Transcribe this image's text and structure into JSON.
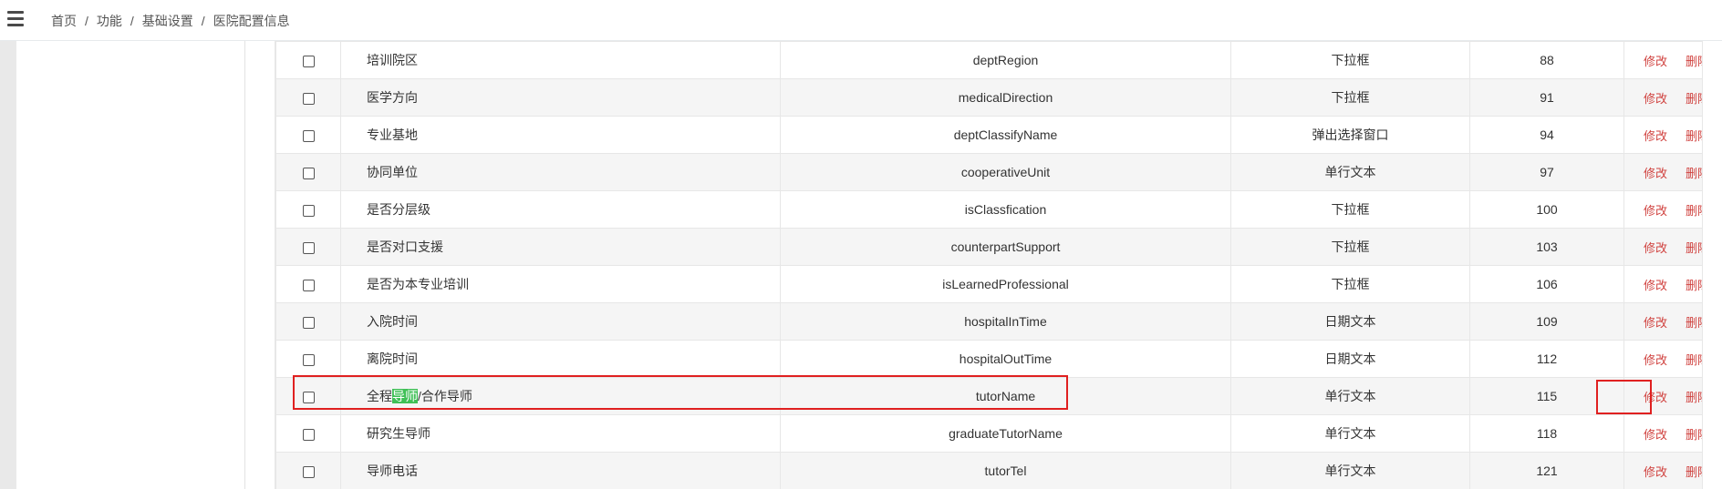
{
  "breadcrumb": [
    "首页",
    "功能",
    "基础设置",
    "医院配置信息"
  ],
  "rows": [
    {
      "name": "培训院区",
      "field": "deptRegion",
      "type": "下拉框",
      "order": "88"
    },
    {
      "name": "医学方向",
      "field": "medicalDirection",
      "type": "下拉框",
      "order": "91"
    },
    {
      "name": "专业基地",
      "field": "deptClassifyName",
      "type": "弹出选择窗口",
      "order": "94"
    },
    {
      "name": "协同单位",
      "field": "cooperativeUnit",
      "type": "单行文本",
      "order": "97"
    },
    {
      "name": "是否分层级",
      "field": "isClassfication",
      "type": "下拉框",
      "order": "100"
    },
    {
      "name": "是否对口支援",
      "field": "counterpartSupport",
      "type": "下拉框",
      "order": "103"
    },
    {
      "name": "是否为本专业培训",
      "field": "isLearnedProfessional",
      "type": "下拉框",
      "order": "106"
    },
    {
      "name": "入院时间",
      "field": "hospitalInTime",
      "type": "日期文本",
      "order": "109"
    },
    {
      "name": "离院时间",
      "field": "hospitalOutTime",
      "type": "日期文本",
      "order": "112"
    },
    {
      "name_pre": "全程",
      "name_hl": "导师",
      "name_post": "/合作导师",
      "field": "tutorName",
      "type": "单行文本",
      "order": "115"
    },
    {
      "name": "研究生导师",
      "field": "graduateTutorName",
      "type": "单行文本",
      "order": "118"
    },
    {
      "name": "导师电话",
      "field": "tutorTel",
      "type": "单行文本",
      "order": "121"
    }
  ],
  "actions": {
    "edit": "修改",
    "delete": "删除"
  },
  "highlight_color": "#40c057",
  "annotation_color": "#e02020",
  "action_color": "#d0423f"
}
